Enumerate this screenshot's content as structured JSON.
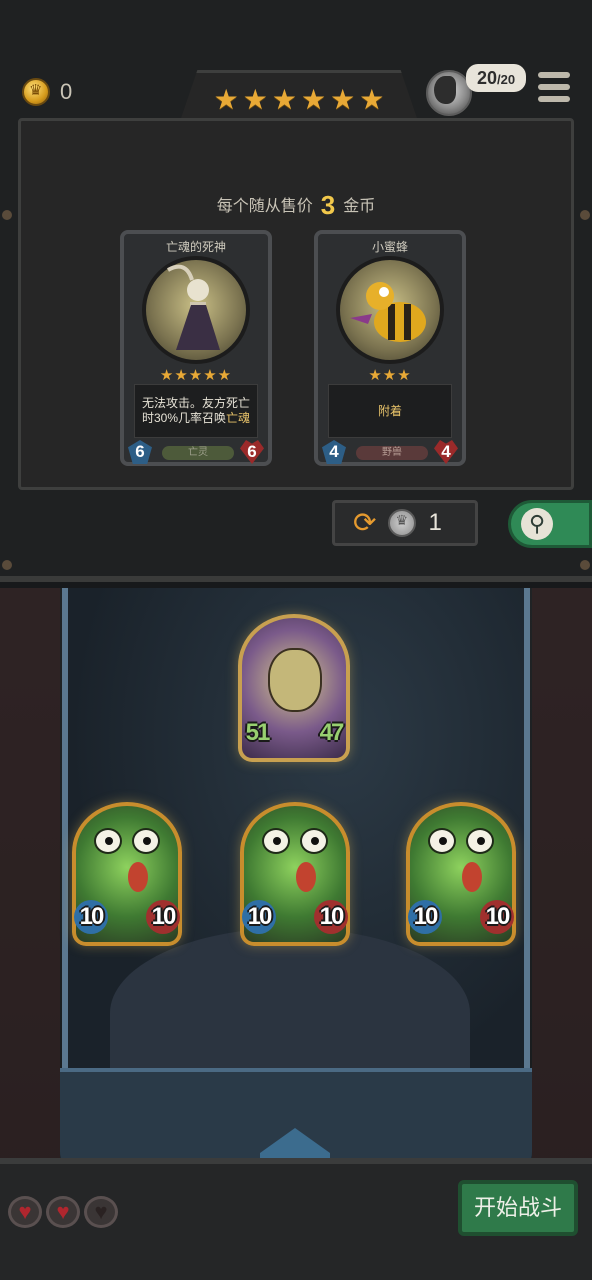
{
  "header": {
    "gold": "0",
    "stars": [
      "★",
      "★",
      "★",
      "★",
      "★",
      "★"
    ],
    "hero_hp_current": "20",
    "hero_hp_max": "20",
    "hero_icon": "hero-portrait-icon",
    "menu_icon": "hamburger-menu-icon"
  },
  "shop": {
    "price_prefix": "每个随从售价",
    "price_value": "3",
    "price_suffix": "金币",
    "cards": [
      {
        "name": "亡魂的死神",
        "stars": "★★★★★",
        "desc": "无法攻击。友方死亡时30%几率召唤",
        "desc_highlight": "亡魂",
        "attack": "6",
        "health": "6",
        "tribe": "亡灵"
      },
      {
        "name": "小蜜蜂",
        "stars": "★★★",
        "desc": "",
        "desc_highlight": "附着",
        "attack": "4",
        "health": "4",
        "tribe": "野兽"
      }
    ],
    "refresh_cost": "1",
    "refresh_icon": "refresh-icon",
    "search_icon": "search-icon"
  },
  "board": {
    "enemy": {
      "attack": "51",
      "health": "47"
    },
    "minions": [
      {
        "attack": "10",
        "health": "10"
      },
      {
        "attack": "10",
        "health": "10"
      },
      {
        "attack": "10",
        "health": "10"
      }
    ]
  },
  "footer": {
    "lives": [
      "♥",
      "♥",
      "♥"
    ],
    "start_label": "开始战斗"
  }
}
